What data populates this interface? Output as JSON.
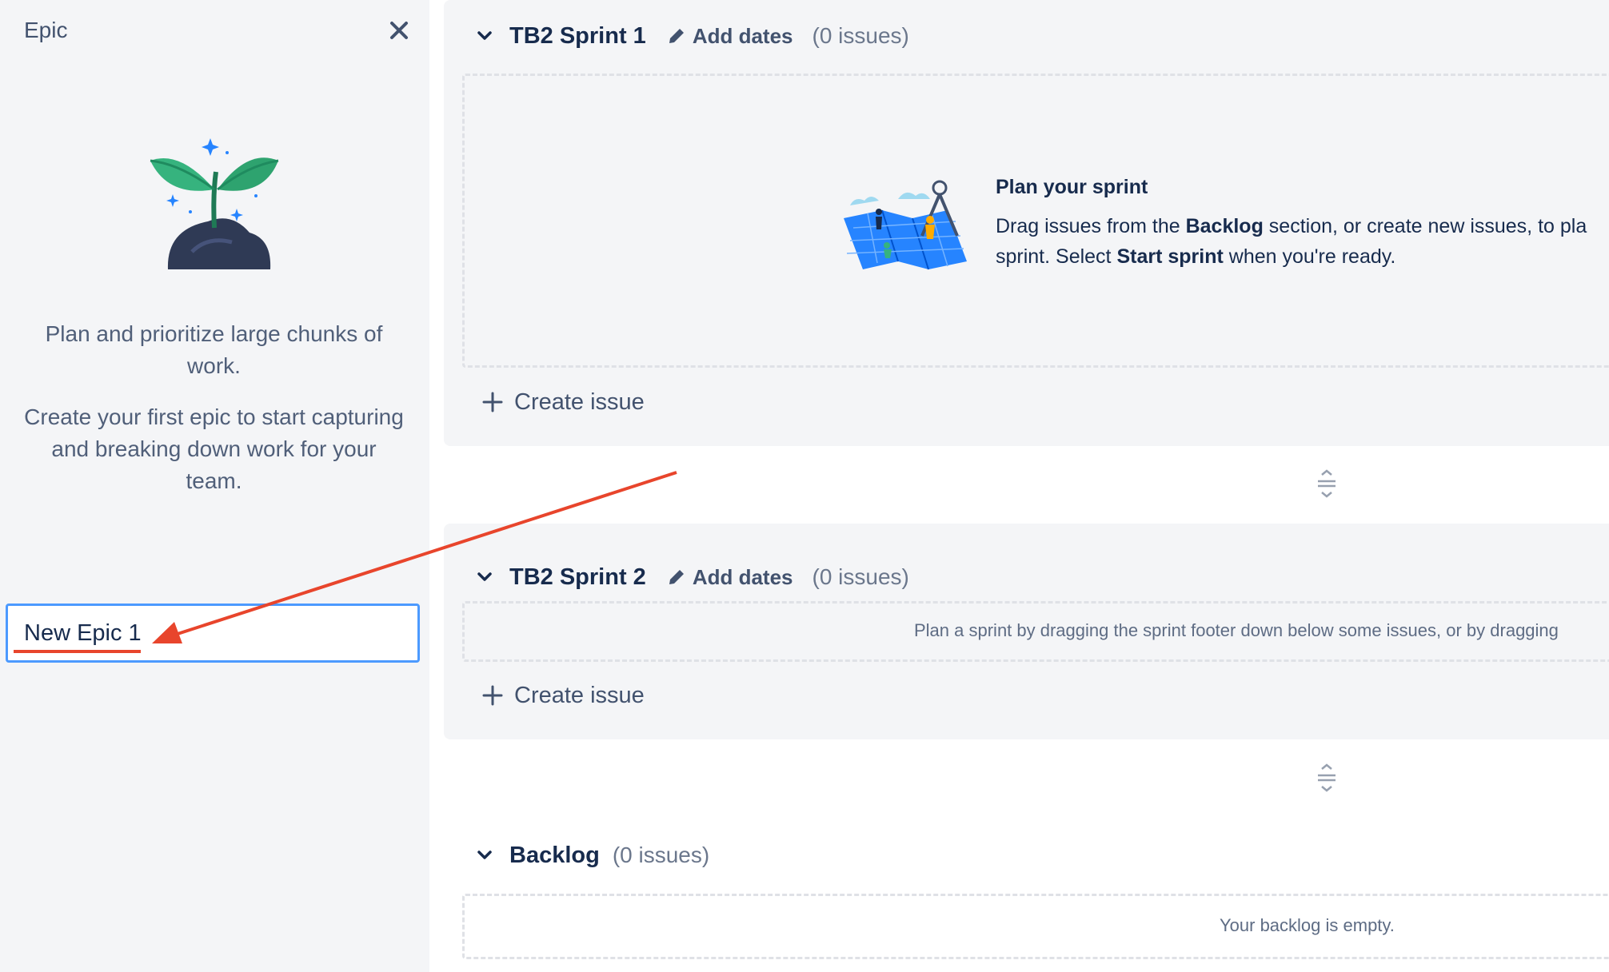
{
  "epic_panel": {
    "title": "Epic",
    "description_1": "Plan and prioritize large chunks of work.",
    "description_2": "Create your first epic to start capturing and breaking down work for your team.",
    "input_value": "New Epic 1"
  },
  "sprints": [
    {
      "name": "TB2 Sprint 1",
      "add_dates_label": "Add dates",
      "issue_count": "(0 issues)",
      "empty_title": "Plan your sprint",
      "empty_text_1": "Drag issues from the ",
      "empty_bold_1": "Backlog",
      "empty_text_2": " section, or create new issues, to pla",
      "empty_text_3": "sprint. Select ",
      "empty_bold_2": "Start sprint",
      "empty_text_4": " when you're ready.",
      "create_issue_label": "Create issue"
    },
    {
      "name": "TB2 Sprint 2",
      "add_dates_label": "Add dates",
      "issue_count": "(0 issues)",
      "hint": "Plan a sprint by dragging the sprint footer down below some issues, or by dragging",
      "create_issue_label": "Create issue"
    }
  ],
  "backlog": {
    "name": "Backlog",
    "issue_count": "(0 issues)",
    "empty_text": "Your backlog is empty."
  },
  "colors": {
    "annotation": "#e8452c",
    "focus_border": "#4c9aff",
    "panel_bg": "#f4f5f7"
  }
}
